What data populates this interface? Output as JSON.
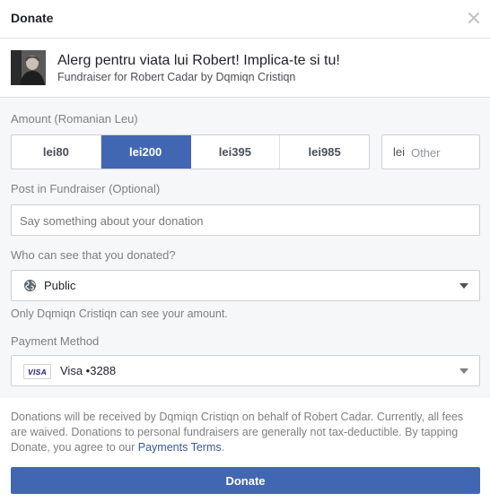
{
  "header": {
    "title": "Donate"
  },
  "fundraiser": {
    "title": "Alerg pentru viata lui Robert! Implica-te si tu!",
    "subtitle": "Fundraiser for Robert Cadar by Dqmiqn Cristiqn"
  },
  "amount": {
    "label": "Amount (Romanian Leu)",
    "options": [
      "lei80",
      "lei200",
      "lei395",
      "lei985"
    ],
    "selected": "lei200",
    "currency_prefix": "lei",
    "other_placeholder": "Other"
  },
  "post": {
    "label": "Post in Fundraiser (Optional)",
    "placeholder": "Say something about your donation"
  },
  "visibility": {
    "label": "Who can see that you donated?",
    "value": "Public",
    "icon": "globe-icon",
    "note": "Only Dqmiqn Cristiqn can see your amount."
  },
  "payment": {
    "label": "Payment Method",
    "card_brand": "VISA",
    "value": "Visa •3288"
  },
  "footer": {
    "text": "Donations will be received by Dqmiqn Cristiqn on behalf of Robert Cadar. Currently, all fees are waived. Donations to personal fundraisers are generally not tax-deductible. By tapping Donate, you agree to our ",
    "link": "Payments Terms",
    "end": "."
  },
  "donate_button": {
    "label": "Donate"
  },
  "colors": {
    "brand_blue": "#4267b2",
    "link_blue": "#365899",
    "body_bg": "#f6f7f9",
    "border": "#ccd0d5",
    "muted_text": "#7f7f7f"
  }
}
